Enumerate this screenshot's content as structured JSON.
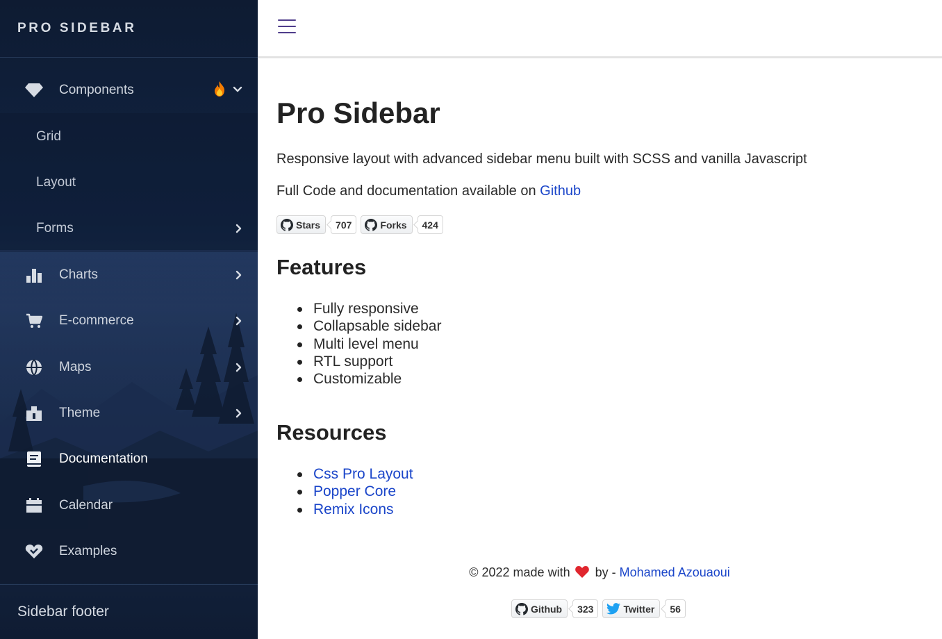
{
  "sidebar": {
    "brand": "PRO SIDEBAR",
    "items": [
      {
        "label": "Components",
        "icon": "diamond-icon",
        "badge_icon": "fire-icon",
        "expanded": true
      },
      {
        "label": "Grid"
      },
      {
        "label": "Layout"
      },
      {
        "label": "Forms",
        "icon": "chevron-right-icon"
      },
      {
        "label": "Charts",
        "icon": "bar-chart-icon"
      },
      {
        "label": "E-commerce",
        "icon": "shopping-cart-icon"
      },
      {
        "label": "Maps",
        "icon": "globe-icon"
      },
      {
        "label": "Theme",
        "icon": "brush-icon"
      },
      {
        "label": "Documentation",
        "icon": "book-icon"
      },
      {
        "label": "Calendar",
        "icon": "calendar-icon"
      },
      {
        "label": "Examples",
        "icon": "service-heart-icon"
      }
    ],
    "footer": "Sidebar footer"
  },
  "topbar": {
    "menu_icon": "hamburger-icon"
  },
  "main": {
    "title": "Pro Sidebar",
    "description": "Responsive layout with advanced sidebar menu built with SCSS and vanilla Javascript",
    "code_text": "Full Code and documentation available on ",
    "code_link": "Github",
    "badges": [
      {
        "label": "Stars",
        "count": "707"
      },
      {
        "label": "Forks",
        "count": "424"
      }
    ],
    "features_heading": "Features",
    "features": [
      "Fully responsive",
      "Collapsable sidebar",
      "Multi level menu",
      "RTL support",
      "Customizable"
    ],
    "resources_heading": "Resources",
    "resources": [
      "Css Pro Layout",
      "Popper Core",
      "Remix Icons"
    ]
  },
  "footer": {
    "prefix": "© 2022 made with",
    "by": "by - ",
    "author": "Mohamed Azouaoui",
    "badges": [
      {
        "label": "Github",
        "count": "323"
      },
      {
        "label": "Twitter",
        "count": "56"
      }
    ]
  },
  "colors": {
    "sidebar_bg": "#112443",
    "accent": "#4f3d8b",
    "link": "#1a45c9",
    "heart": "#e0262e",
    "fire": "#f57c00",
    "twitter": "#1da1f2"
  }
}
